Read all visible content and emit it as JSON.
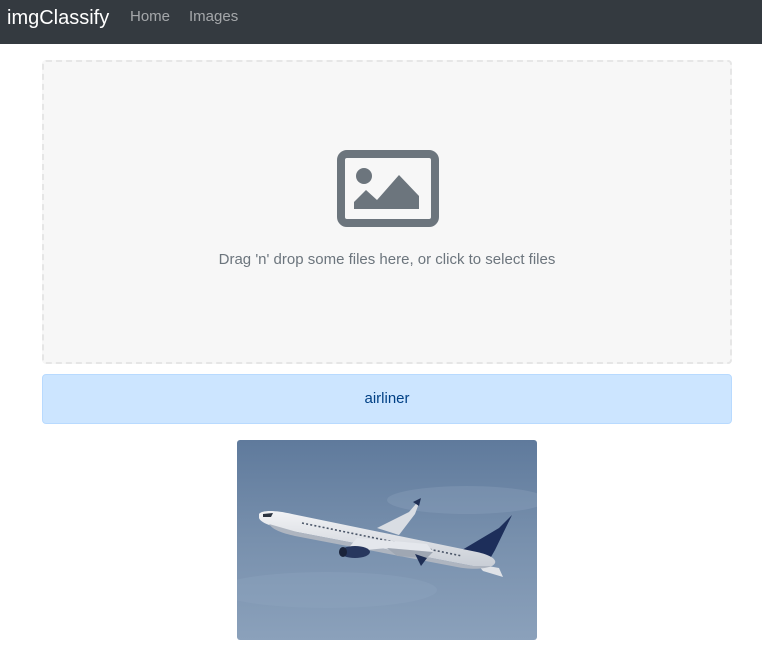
{
  "navbar": {
    "brand": "imgClassify",
    "links": [
      {
        "label": "Home"
      },
      {
        "label": "Images"
      }
    ],
    "background": "#343a40"
  },
  "dropzone": {
    "icon": "image-icon",
    "text": "Drag 'n' drop some files here, or click to select files"
  },
  "result": {
    "label": "airliner",
    "color": "#cce5ff"
  },
  "preview": {
    "subject": "airplane-photo"
  }
}
